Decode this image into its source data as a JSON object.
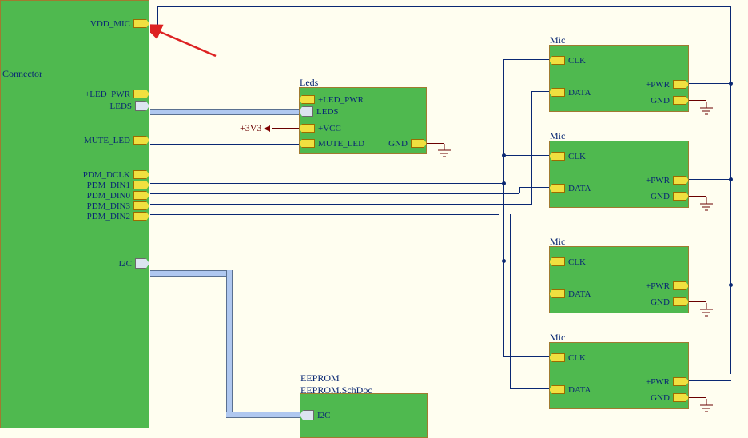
{
  "connector": {
    "title": "Connector",
    "ports": {
      "vdd_mic": "VDD_MIC",
      "led_pwr": "+LED_PWR",
      "leds": "LEDS",
      "mute_led": "MUTE_LED",
      "pdm_dclk": "PDM_DCLK",
      "pdm_din1": "PDM_DIN1",
      "pdm_din0": "PDM_DIN0",
      "pdm_din3": "PDM_DIN3",
      "pdm_din2": "PDM_DIN2",
      "i2c": "I2C"
    }
  },
  "leds": {
    "title": "Leds",
    "ports": {
      "led_pwr": "+LED_PWR",
      "leds": "LEDS",
      "vcc": "+VCC",
      "mute_led": "MUTE_LED",
      "gnd": "GND"
    }
  },
  "eeprom": {
    "title": "EEPROM",
    "subtitle": "EEPROM.SchDoc",
    "ports": {
      "i2c": "I2C"
    }
  },
  "mic": {
    "title": "Mic",
    "ports": {
      "clk": "CLK",
      "data": "DATA",
      "pwr": "+PWR",
      "gnd": "GND"
    }
  },
  "power": {
    "v3v3": "+3V3"
  }
}
